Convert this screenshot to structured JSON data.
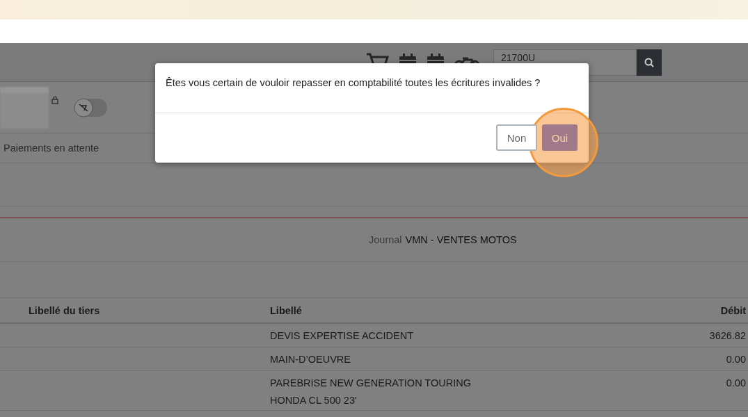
{
  "toolbar": {
    "search": {
      "value": "21700U"
    }
  },
  "toggle": {
    "on": false
  },
  "tabs": [
    {
      "label": "Paiements en attente",
      "selected": false
    }
  ],
  "journal": {
    "label": "Journal",
    "value": "VMN - VENTES MOTOS"
  },
  "table": {
    "columns": [
      "Libellé du tiers",
      "Libellé",
      "Débit"
    ],
    "rows": [
      {
        "tiers": "",
        "libelle": [
          "DEVIS EXPERTISE ACCIDENT"
        ],
        "debit": "3626.82"
      },
      {
        "tiers": "",
        "libelle": [
          "MAIN-D’OEUVRE"
        ],
        "debit": "0.00"
      },
      {
        "tiers": "",
        "libelle": [
          "PAREBRISE NEW GENERATION TOURING",
          "HONDA CL 500 23'"
        ],
        "debit": "0.00"
      }
    ]
  },
  "dialog": {
    "message": "Êtes vous certain de vouloir repasser en comptabilité toutes les écritures invalides ?",
    "buttons": [
      {
        "label": "Non",
        "kind": "secondary"
      },
      {
        "label": "Oui",
        "kind": "primary"
      }
    ]
  }
}
